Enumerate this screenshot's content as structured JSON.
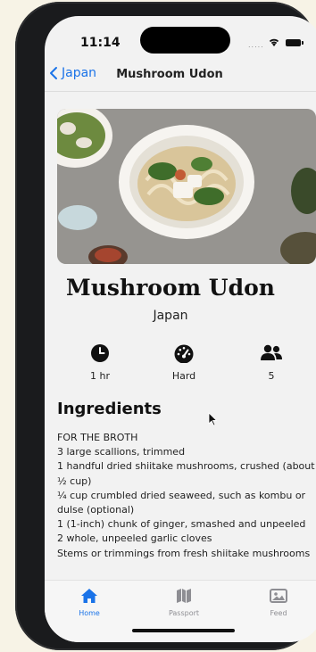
{
  "status_bar": {
    "time": "11:14",
    "signal": "....."
  },
  "nav": {
    "back_label": "Japan",
    "title": "Mushroom Udon"
  },
  "recipe": {
    "title": "Mushroom Udon",
    "subtitle": "Japan",
    "meta": [
      {
        "icon": "clock-icon",
        "label": "1 hr"
      },
      {
        "icon": "gauge-icon",
        "label": "Hard"
      },
      {
        "icon": "people-icon",
        "label": "5"
      }
    ]
  },
  "ingredients": {
    "heading": "Ingredients",
    "lines": [
      "FOR THE BROTH",
      "3 large scallions, trimmed",
      "1 handful dried shiitake mushrooms, crushed (about ½ cup)",
      "¼ cup crumbled dried seaweed, such as kombu or dulse (optional)",
      "1 (1-inch) chunk of ginger, smashed and unpeeled",
      "2 whole, unpeeled garlic cloves",
      "Stems or trimmings from fresh shiitake mushrooms"
    ]
  },
  "tabs": [
    {
      "icon": "home-icon",
      "label": "Home",
      "active": true
    },
    {
      "icon": "map-icon",
      "label": "Passport",
      "active": false
    },
    {
      "icon": "photo-icon",
      "label": "Feed",
      "active": false
    }
  ],
  "colors": {
    "accent": "#1a73e8",
    "inactive": "#8e8e93"
  }
}
